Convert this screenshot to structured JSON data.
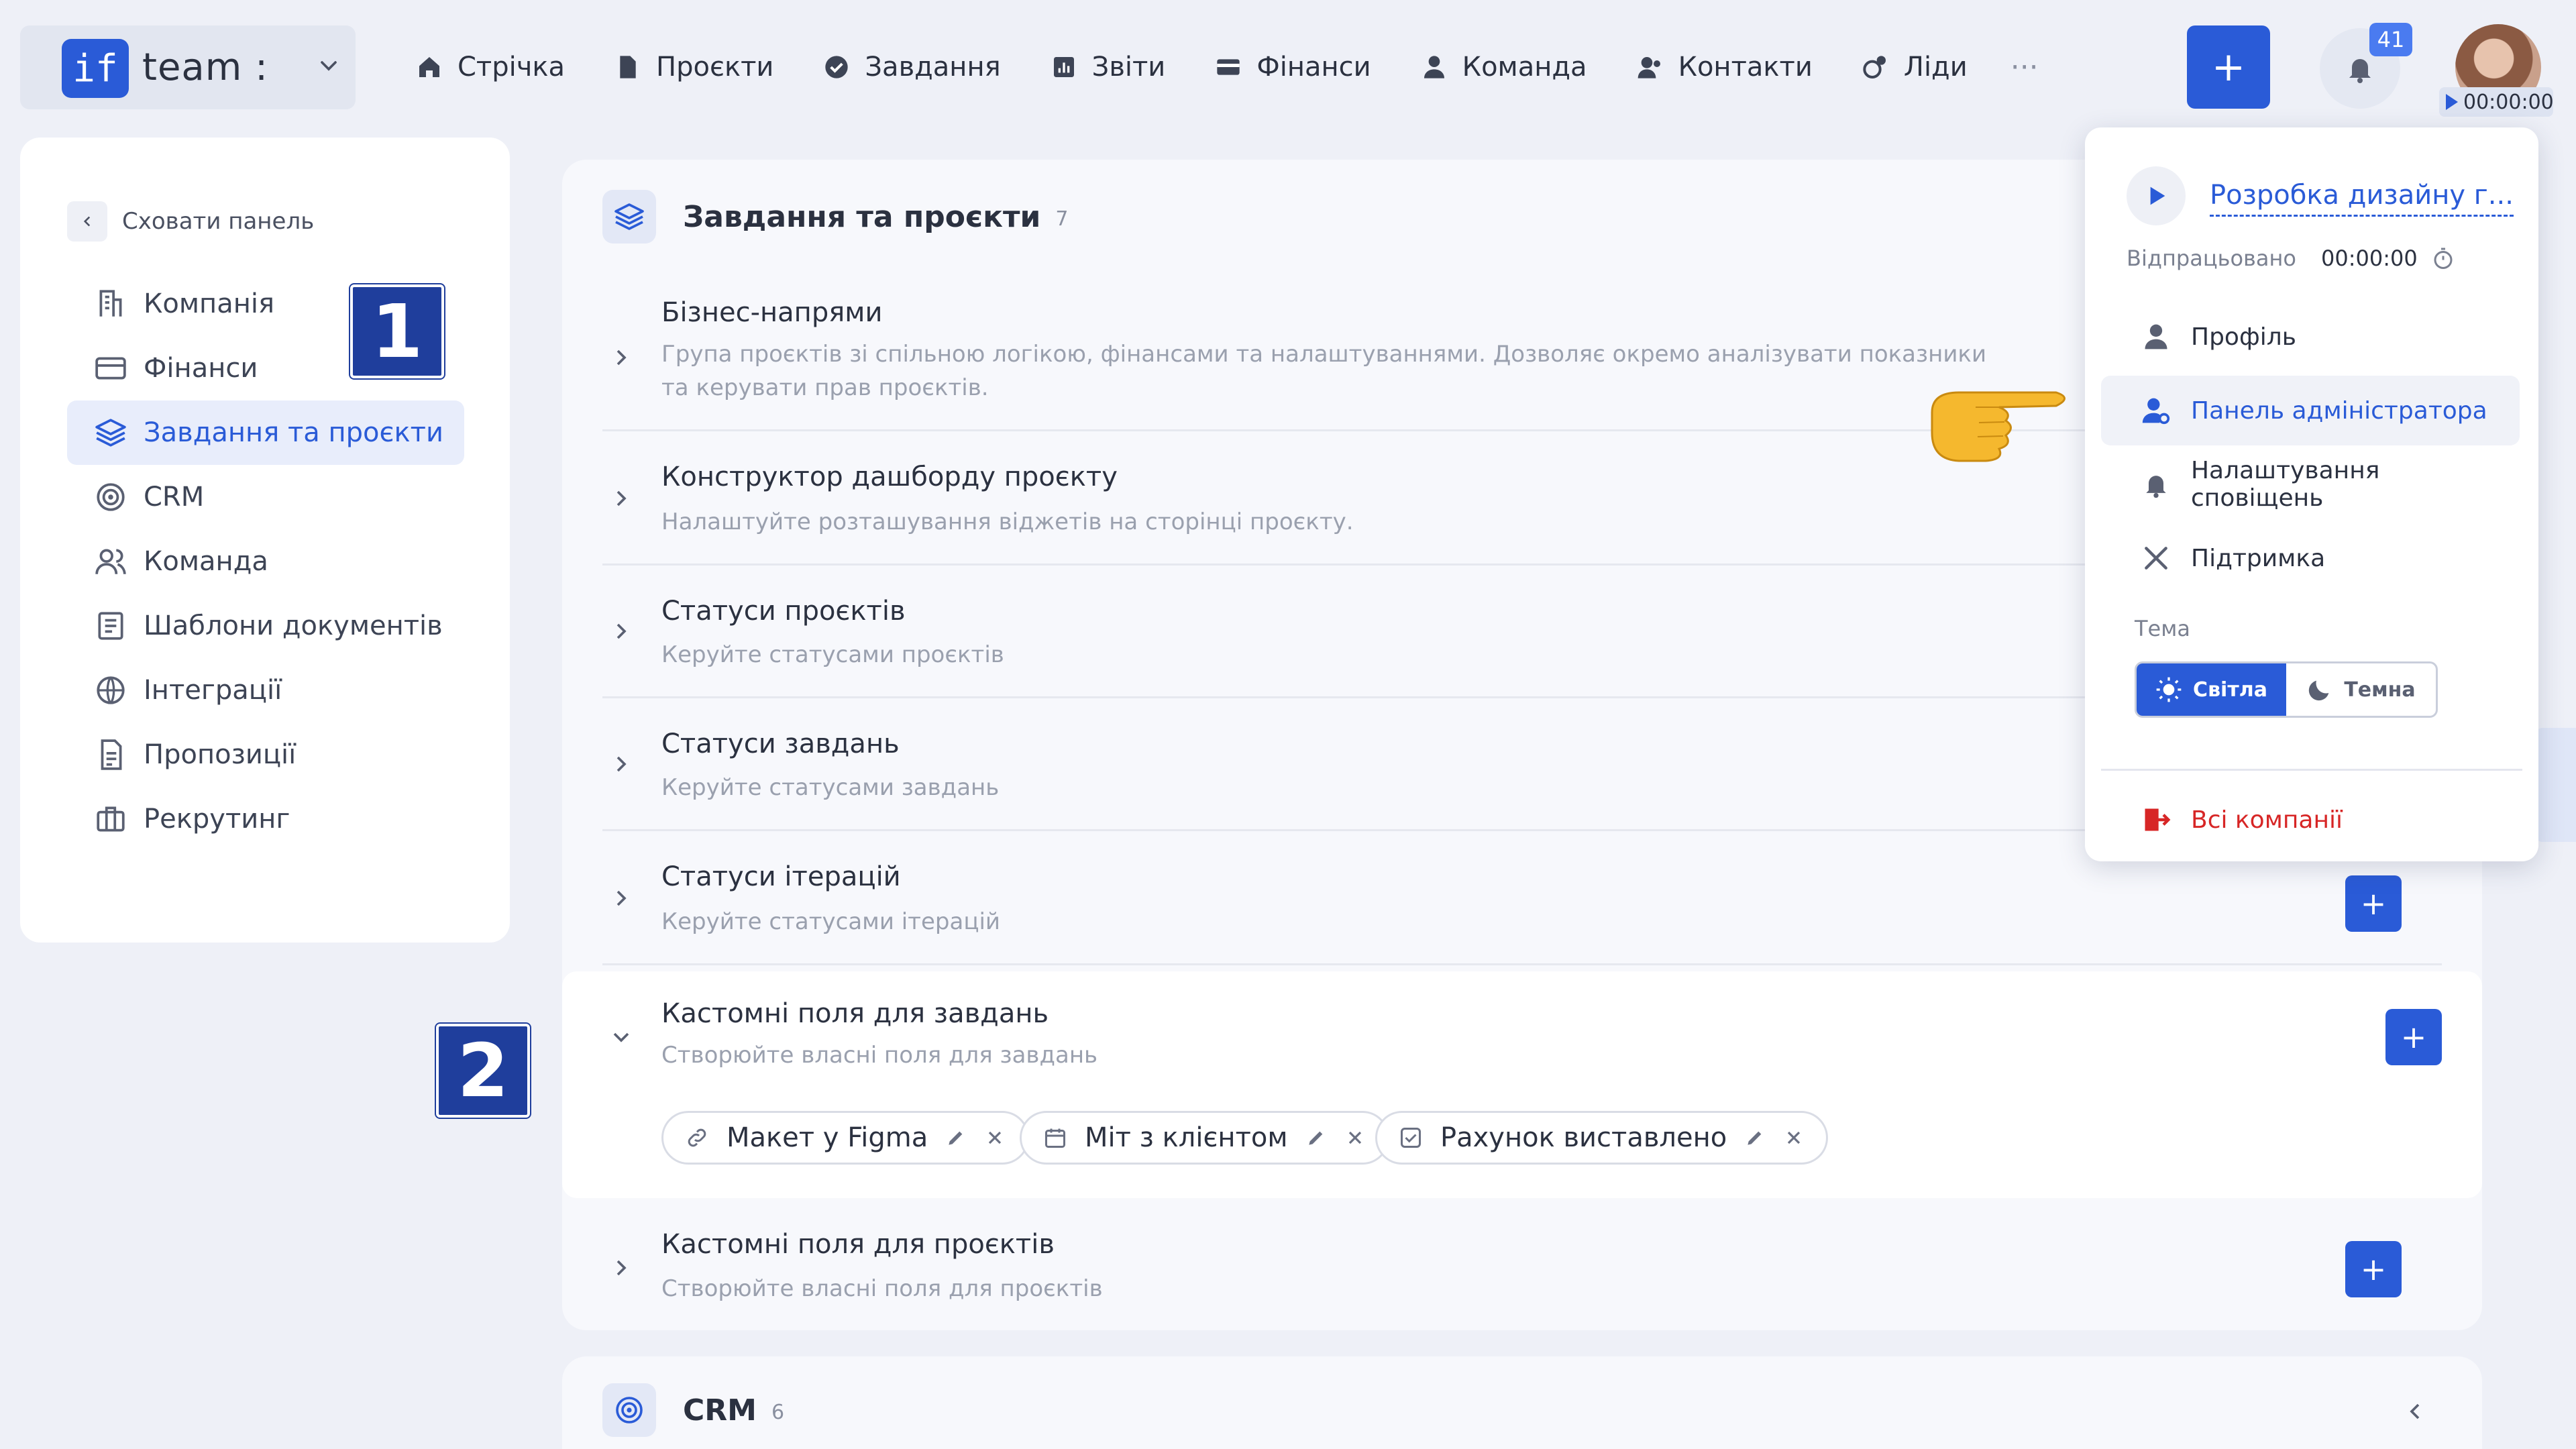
{
  "brand": {
    "logo": "if",
    "name": "team :"
  },
  "nav": [
    {
      "label": "Стрічка",
      "icon": "home-icon"
    },
    {
      "label": "Проєкти",
      "icon": "file-icon"
    },
    {
      "label": "Завдання",
      "icon": "check-circle-icon"
    },
    {
      "label": "Звіти",
      "icon": "report-icon"
    },
    {
      "label": "Фінанси",
      "icon": "wallet-icon"
    },
    {
      "label": "Команда",
      "icon": "user-icon"
    },
    {
      "label": "Контакти",
      "icon": "contacts-icon"
    },
    {
      "label": "Ліди",
      "icon": "leads-icon"
    }
  ],
  "nav_more": "···",
  "add_label": "+",
  "notifications_count": "41",
  "timer_value": "00:00:00",
  "sidebar": {
    "hide_label": "Сховати панель",
    "items": [
      {
        "label": "Компанія",
        "icon": "company-icon"
      },
      {
        "label": "Фінанси",
        "icon": "finance-icon"
      },
      {
        "label": "Завдання та проєкти",
        "icon": "layers-icon",
        "active": true
      },
      {
        "label": "CRM",
        "icon": "target-icon"
      },
      {
        "label": "Команда",
        "icon": "team-icon"
      },
      {
        "label": "Шаблони документів",
        "icon": "document-template-icon"
      },
      {
        "label": "Інтеграції",
        "icon": "globe-icon"
      },
      {
        "label": "Пропозиції",
        "icon": "proposal-icon"
      },
      {
        "label": "Рекрутинг",
        "icon": "briefcase-icon"
      }
    ]
  },
  "callouts": {
    "one": "1",
    "two": "2"
  },
  "main": {
    "title": "Завдання та проєкти",
    "count": "7",
    "rows": [
      {
        "title": "Бізнес-напрями",
        "desc": "Група проєктів зі спільною логікою, фінансами та налаштуваннями. Дозволяє окремо аналізувати показники та керувати прав проєктів."
      },
      {
        "title": "Конструктор дашборду проєкту",
        "desc": "Налаштуйте розташування віджетів на сторінці проєкту."
      },
      {
        "title": "Статуси проєктів",
        "desc": "Керуйте статусами проєктів"
      },
      {
        "title": "Статуси завдань",
        "desc": "Керуйте статусами завдань"
      },
      {
        "title": "Статуси ітерацій",
        "desc": "Керуйте статусами ітерацій"
      },
      {
        "title": "Кастомні поля для завдань",
        "desc": "Створюйте власні поля для завдань"
      },
      {
        "title": "Кастомні поля для проєктів",
        "desc": "Створюйте власні поля для проєктів"
      }
    ],
    "chips": [
      {
        "label": "Макет у Figma",
        "icon": "link-icon"
      },
      {
        "label": "Міт з клієнтом",
        "icon": "calendar-icon"
      },
      {
        "label": "Рахунок виставлено",
        "icon": "checkbox-icon"
      }
    ]
  },
  "crm": {
    "title": "CRM",
    "count": "6"
  },
  "dropdown": {
    "task": "Розробка дизайну г...",
    "worked_label": "Відпрацьовано",
    "worked_value": "00:00:00",
    "items": [
      {
        "label": "Профіль",
        "icon": "profile-icon"
      },
      {
        "label": "Панель адміністратора",
        "icon": "admin-icon",
        "active": true
      },
      {
        "label": "Налаштування сповіщень",
        "icon": "bell-icon"
      },
      {
        "label": "Підтримка",
        "icon": "tools-icon"
      }
    ],
    "theme_label": "Тема",
    "theme_light": "Світла",
    "theme_dark": "Темна",
    "logout_label": "Всі компанії"
  },
  "colors": {
    "accent": "#2a5bd7",
    "danger": "#d72626",
    "callout": "#1f3e9c"
  }
}
